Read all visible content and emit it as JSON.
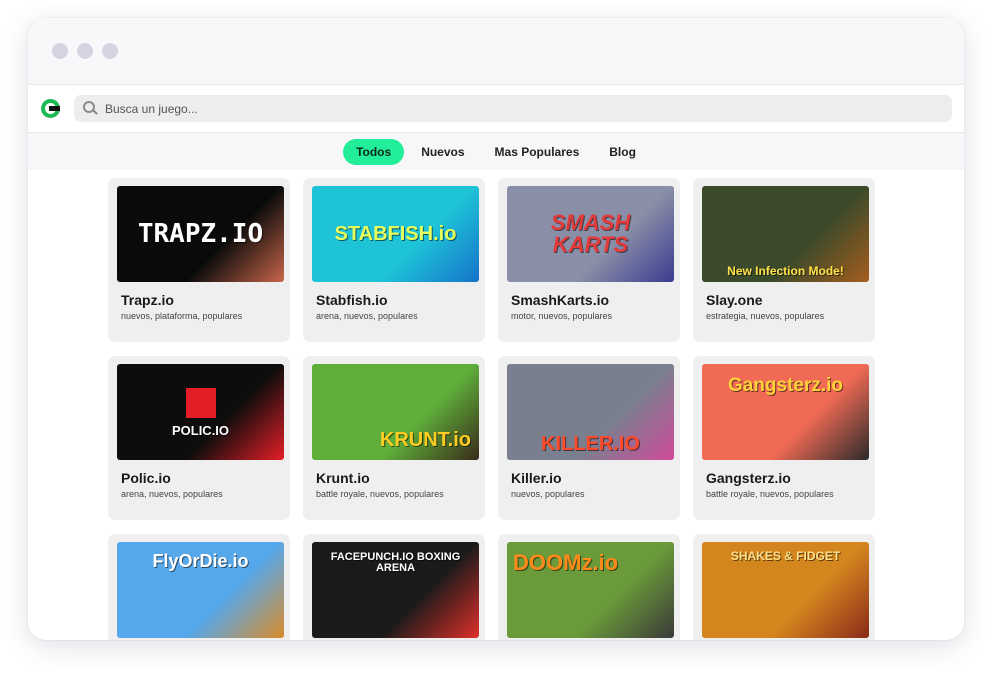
{
  "search": {
    "placeholder": "Busca un juego..."
  },
  "nav": [
    "Todos",
    "Nuevos",
    "Mas Populares",
    "Blog"
  ],
  "games": [
    {
      "title": "Trapz.io",
      "tags": "nuevos, plataforma, populares",
      "art": "TRAPZ.IO",
      "bg": "#0a0a0a",
      "fg": "#ffffff",
      "accent": "#c8664a"
    },
    {
      "title": "Stabfish.io",
      "tags": "arena, nuevos, populares",
      "art": "STABFISH.io",
      "bg": "#1ec3d8",
      "fg": "#e6ff5a",
      "accent": "#1572c9"
    },
    {
      "title": "SmashKarts.io",
      "tags": "motor, nuevos, populares",
      "art": "SMASH KARTS",
      "bg": "#8a8fa8",
      "fg": "#e33a3a",
      "accent": "#3b3b8f"
    },
    {
      "title": "Slay.one",
      "tags": "estrategia, nuevos, populares",
      "art": "New Infection Mode!",
      "bg": "#3b4a2a",
      "fg": "#ffe34a",
      "accent": "#a55d1e"
    },
    {
      "title": "Polic.io",
      "tags": "arena, nuevos, populares",
      "art": "POLIC.IO",
      "bg": "#0d0d0d",
      "fg": "#ffffff",
      "accent": "#e41e26"
    },
    {
      "title": "Krunt.io",
      "tags": "battle royale, nuevos, populares",
      "art": "KRUNT.io",
      "bg": "#5fae3a",
      "fg": "#ffcc22",
      "accent": "#3a2a1a"
    },
    {
      "title": "Killer.io",
      "tags": "nuevos, populares",
      "art": "KILLER.IO",
      "bg": "#7a7f8f",
      "fg": "#ff4a2a",
      "accent": "#d04b9a"
    },
    {
      "title": "Gangsterz.io",
      "tags": "battle royale, nuevos, populares",
      "art": "Gangsterz.io",
      "bg": "#f06a55",
      "fg": "#ffd23a",
      "accent": "#2a2a2a"
    },
    {
      "title": "",
      "tags": "",
      "art": "FlyOrDie.io",
      "bg": "#56a8ea",
      "fg": "#ffffff",
      "accent": "#d98b2a"
    },
    {
      "title": "",
      "tags": "",
      "art": "FACEPUNCH.IO BOXING ARENA",
      "bg": "#1a1a1a",
      "fg": "#ffffff",
      "accent": "#e0302a"
    },
    {
      "title": "",
      "tags": "",
      "art": "DOOMz.io",
      "bg": "#6a9a3a",
      "fg": "#ff8a1a",
      "accent": "#3a3a3a"
    },
    {
      "title": "",
      "tags": "",
      "art": "SHAKES & FIDGET",
      "bg": "#d4861e",
      "fg": "#ffe08a",
      "accent": "#8a2a1a"
    }
  ]
}
